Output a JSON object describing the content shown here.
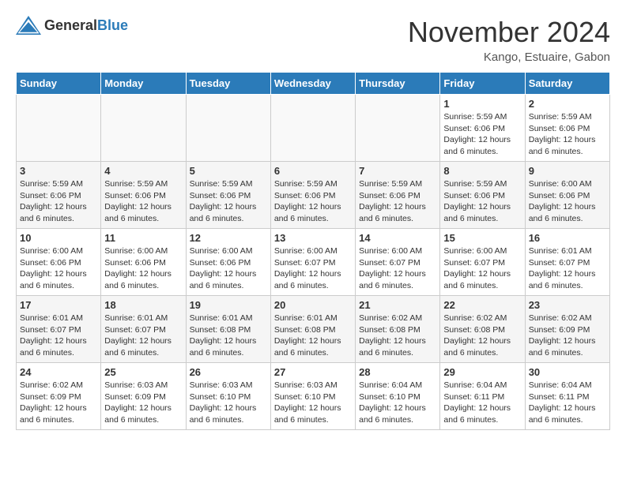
{
  "header": {
    "logo_general": "General",
    "logo_blue": "Blue",
    "month_title": "November 2024",
    "location": "Kango, Estuaire, Gabon"
  },
  "weekdays": [
    "Sunday",
    "Monday",
    "Tuesday",
    "Wednesday",
    "Thursday",
    "Friday",
    "Saturday"
  ],
  "weeks": [
    [
      {
        "day": null
      },
      {
        "day": null
      },
      {
        "day": null
      },
      {
        "day": null
      },
      {
        "day": null
      },
      {
        "day": "1",
        "sunrise": "Sunrise: 5:59 AM",
        "sunset": "Sunset: 6:06 PM",
        "daylight": "Daylight: 12 hours and 6 minutes."
      },
      {
        "day": "2",
        "sunrise": "Sunrise: 5:59 AM",
        "sunset": "Sunset: 6:06 PM",
        "daylight": "Daylight: 12 hours and 6 minutes."
      }
    ],
    [
      {
        "day": "3",
        "sunrise": "Sunrise: 5:59 AM",
        "sunset": "Sunset: 6:06 PM",
        "daylight": "Daylight: 12 hours and 6 minutes."
      },
      {
        "day": "4",
        "sunrise": "Sunrise: 5:59 AM",
        "sunset": "Sunset: 6:06 PM",
        "daylight": "Daylight: 12 hours and 6 minutes."
      },
      {
        "day": "5",
        "sunrise": "Sunrise: 5:59 AM",
        "sunset": "Sunset: 6:06 PM",
        "daylight": "Daylight: 12 hours and 6 minutes."
      },
      {
        "day": "6",
        "sunrise": "Sunrise: 5:59 AM",
        "sunset": "Sunset: 6:06 PM",
        "daylight": "Daylight: 12 hours and 6 minutes."
      },
      {
        "day": "7",
        "sunrise": "Sunrise: 5:59 AM",
        "sunset": "Sunset: 6:06 PM",
        "daylight": "Daylight: 12 hours and 6 minutes."
      },
      {
        "day": "8",
        "sunrise": "Sunrise: 5:59 AM",
        "sunset": "Sunset: 6:06 PM",
        "daylight": "Daylight: 12 hours and 6 minutes."
      },
      {
        "day": "9",
        "sunrise": "Sunrise: 6:00 AM",
        "sunset": "Sunset: 6:06 PM",
        "daylight": "Daylight: 12 hours and 6 minutes."
      }
    ],
    [
      {
        "day": "10",
        "sunrise": "Sunrise: 6:00 AM",
        "sunset": "Sunset: 6:06 PM",
        "daylight": "Daylight: 12 hours and 6 minutes."
      },
      {
        "day": "11",
        "sunrise": "Sunrise: 6:00 AM",
        "sunset": "Sunset: 6:06 PM",
        "daylight": "Daylight: 12 hours and 6 minutes."
      },
      {
        "day": "12",
        "sunrise": "Sunrise: 6:00 AM",
        "sunset": "Sunset: 6:06 PM",
        "daylight": "Daylight: 12 hours and 6 minutes."
      },
      {
        "day": "13",
        "sunrise": "Sunrise: 6:00 AM",
        "sunset": "Sunset: 6:07 PM",
        "daylight": "Daylight: 12 hours and 6 minutes."
      },
      {
        "day": "14",
        "sunrise": "Sunrise: 6:00 AM",
        "sunset": "Sunset: 6:07 PM",
        "daylight": "Daylight: 12 hours and 6 minutes."
      },
      {
        "day": "15",
        "sunrise": "Sunrise: 6:00 AM",
        "sunset": "Sunset: 6:07 PM",
        "daylight": "Daylight: 12 hours and 6 minutes."
      },
      {
        "day": "16",
        "sunrise": "Sunrise: 6:01 AM",
        "sunset": "Sunset: 6:07 PM",
        "daylight": "Daylight: 12 hours and 6 minutes."
      }
    ],
    [
      {
        "day": "17",
        "sunrise": "Sunrise: 6:01 AM",
        "sunset": "Sunset: 6:07 PM",
        "daylight": "Daylight: 12 hours and 6 minutes."
      },
      {
        "day": "18",
        "sunrise": "Sunrise: 6:01 AM",
        "sunset": "Sunset: 6:07 PM",
        "daylight": "Daylight: 12 hours and 6 minutes."
      },
      {
        "day": "19",
        "sunrise": "Sunrise: 6:01 AM",
        "sunset": "Sunset: 6:08 PM",
        "daylight": "Daylight: 12 hours and 6 minutes."
      },
      {
        "day": "20",
        "sunrise": "Sunrise: 6:01 AM",
        "sunset": "Sunset: 6:08 PM",
        "daylight": "Daylight: 12 hours and 6 minutes."
      },
      {
        "day": "21",
        "sunrise": "Sunrise: 6:02 AM",
        "sunset": "Sunset: 6:08 PM",
        "daylight": "Daylight: 12 hours and 6 minutes."
      },
      {
        "day": "22",
        "sunrise": "Sunrise: 6:02 AM",
        "sunset": "Sunset: 6:08 PM",
        "daylight": "Daylight: 12 hours and 6 minutes."
      },
      {
        "day": "23",
        "sunrise": "Sunrise: 6:02 AM",
        "sunset": "Sunset: 6:09 PM",
        "daylight": "Daylight: 12 hours and 6 minutes."
      }
    ],
    [
      {
        "day": "24",
        "sunrise": "Sunrise: 6:02 AM",
        "sunset": "Sunset: 6:09 PM",
        "daylight": "Daylight: 12 hours and 6 minutes."
      },
      {
        "day": "25",
        "sunrise": "Sunrise: 6:03 AM",
        "sunset": "Sunset: 6:09 PM",
        "daylight": "Daylight: 12 hours and 6 minutes."
      },
      {
        "day": "26",
        "sunrise": "Sunrise: 6:03 AM",
        "sunset": "Sunset: 6:10 PM",
        "daylight": "Daylight: 12 hours and 6 minutes."
      },
      {
        "day": "27",
        "sunrise": "Sunrise: 6:03 AM",
        "sunset": "Sunset: 6:10 PM",
        "daylight": "Daylight: 12 hours and 6 minutes."
      },
      {
        "day": "28",
        "sunrise": "Sunrise: 6:04 AM",
        "sunset": "Sunset: 6:10 PM",
        "daylight": "Daylight: 12 hours and 6 minutes."
      },
      {
        "day": "29",
        "sunrise": "Sunrise: 6:04 AM",
        "sunset": "Sunset: 6:11 PM",
        "daylight": "Daylight: 12 hours and 6 minutes."
      },
      {
        "day": "30",
        "sunrise": "Sunrise: 6:04 AM",
        "sunset": "Sunset: 6:11 PM",
        "daylight": "Daylight: 12 hours and 6 minutes."
      }
    ]
  ]
}
